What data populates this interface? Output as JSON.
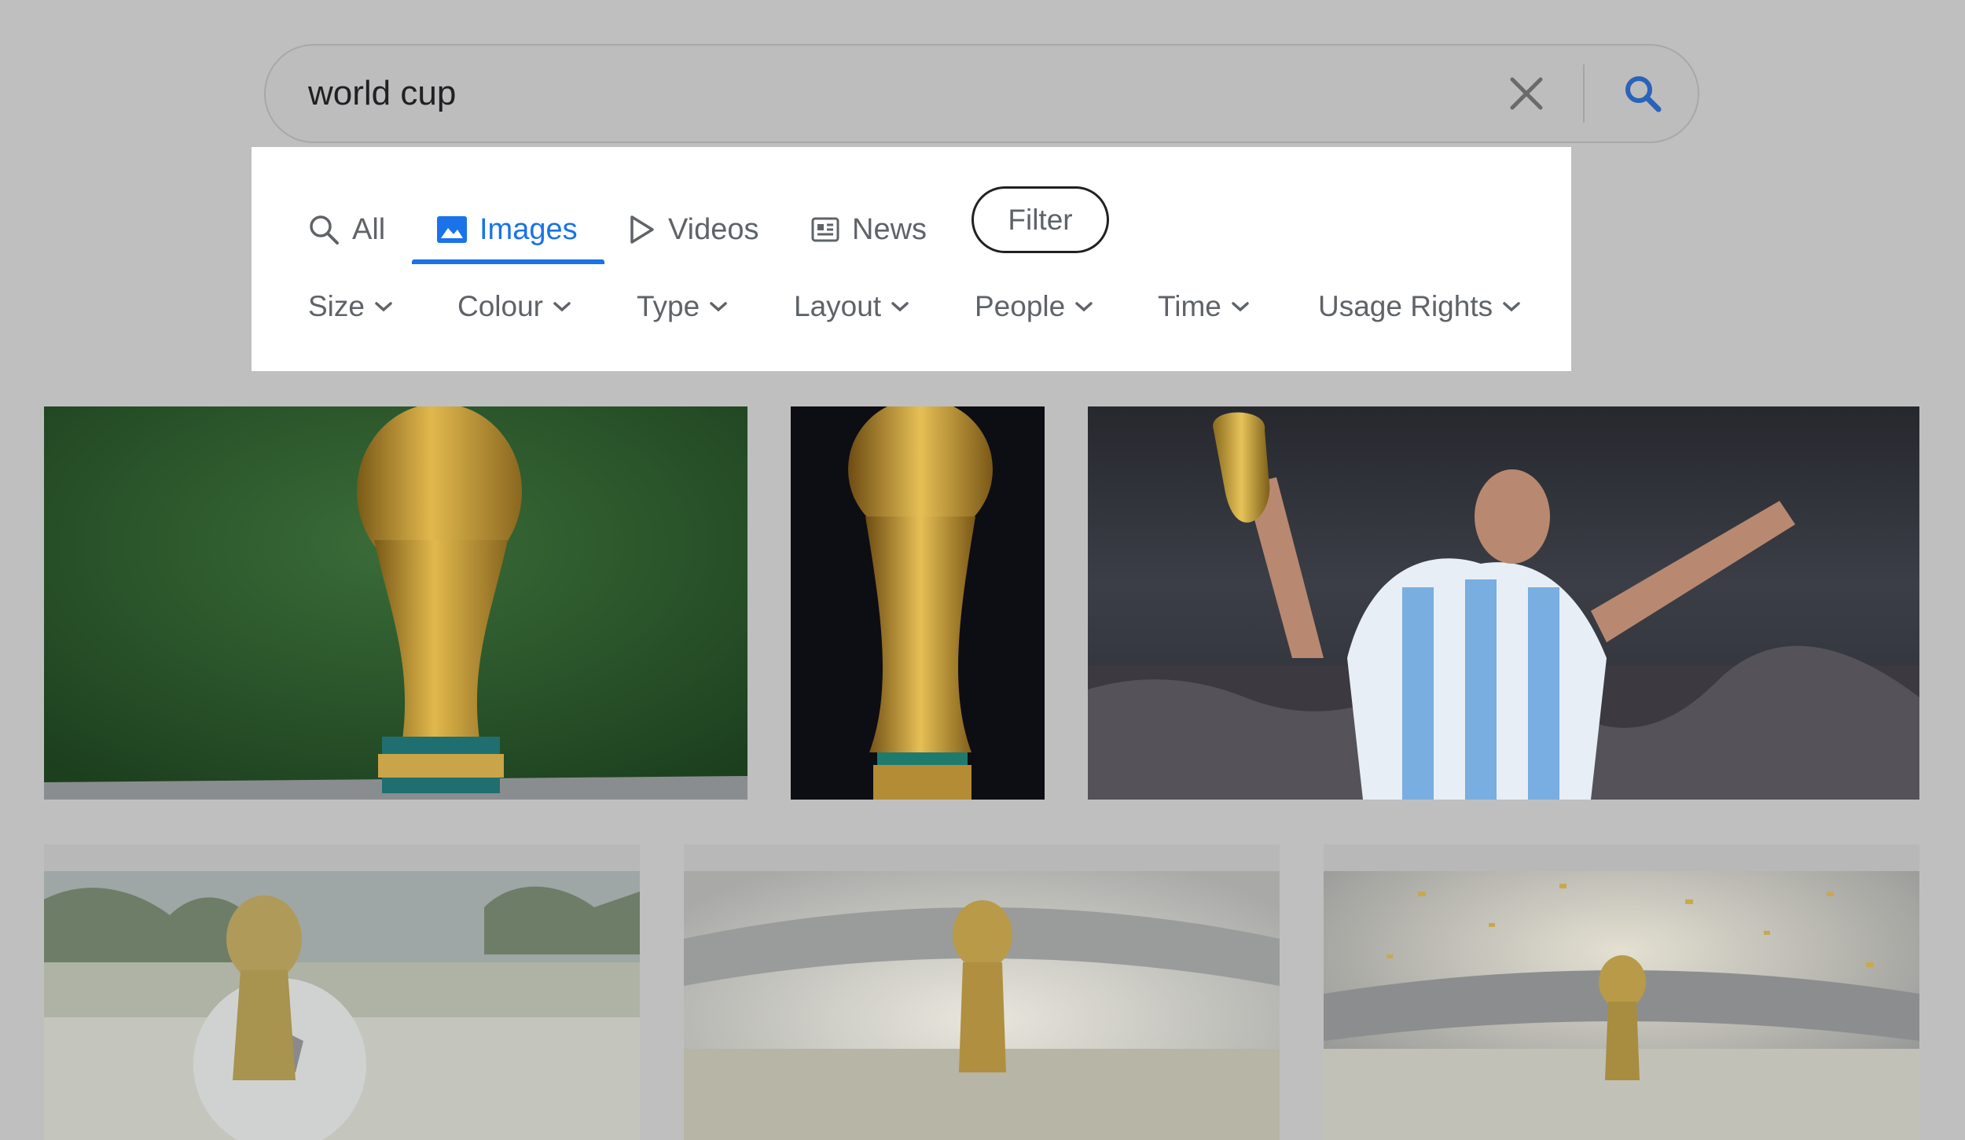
{
  "search": {
    "query": "world cup"
  },
  "tabs": [
    {
      "label": "All",
      "icon": "search-icon"
    },
    {
      "label": "Images",
      "icon": "image-icon",
      "active": true
    },
    {
      "label": "Videos",
      "icon": "play-icon"
    },
    {
      "label": "News",
      "icon": "news-icon"
    }
  ],
  "filter_button": "Filter",
  "filters": [
    "Size",
    "Colour",
    "Type",
    "Layout",
    "People",
    "Time",
    "Usage Rights"
  ],
  "colors": {
    "accent": "#1a73e8",
    "overlay_background": "#bfbfbf",
    "panel_background": "#ffffff"
  },
  "results": [
    {
      "subject": "trophy-on-green"
    },
    {
      "subject": "trophy-on-black"
    },
    {
      "subject": "player-celebrating-with-trophy"
    },
    {
      "subject": "trophy-with-ball-in-stadium"
    },
    {
      "subject": "trophy-in-stadium-glow"
    },
    {
      "subject": "trophy-in-confetti"
    }
  ]
}
